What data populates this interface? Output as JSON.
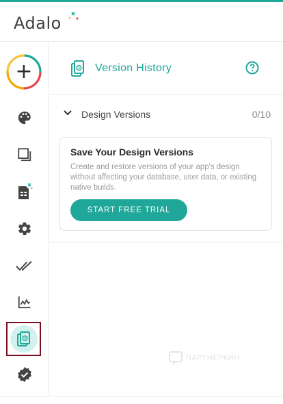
{
  "app": {
    "logo_text": "Adalo"
  },
  "colors": {
    "accent": "#1fa799",
    "active_bg": "#d2f1ec",
    "highlight_border": "#7a1020"
  },
  "sidebar": {
    "items": [
      {
        "name": "add",
        "icon": "plus-icon"
      },
      {
        "name": "branding",
        "icon": "palette-icon"
      },
      {
        "name": "screens",
        "icon": "screens-icon"
      },
      {
        "name": "database",
        "icon": "database-icon"
      },
      {
        "name": "settings",
        "icon": "gear-icon"
      },
      {
        "name": "publish",
        "icon": "double-check-icon"
      },
      {
        "name": "analytics",
        "icon": "chart-icon"
      },
      {
        "name": "version-history",
        "icon": "version-history-icon",
        "active": true
      },
      {
        "name": "verified",
        "icon": "verified-badge-icon"
      }
    ]
  },
  "panel": {
    "title": "Version History",
    "section": {
      "title": "Design Versions",
      "count": "0/10"
    },
    "card": {
      "title": "Save Your Design Versions",
      "text": "Create and restore versions of your app's design without affecting your database, user data, or existing native builds.",
      "button": "START FREE TRIAL"
    }
  },
  "watermark": {
    "text": "ПАРТНЕРКИН"
  }
}
